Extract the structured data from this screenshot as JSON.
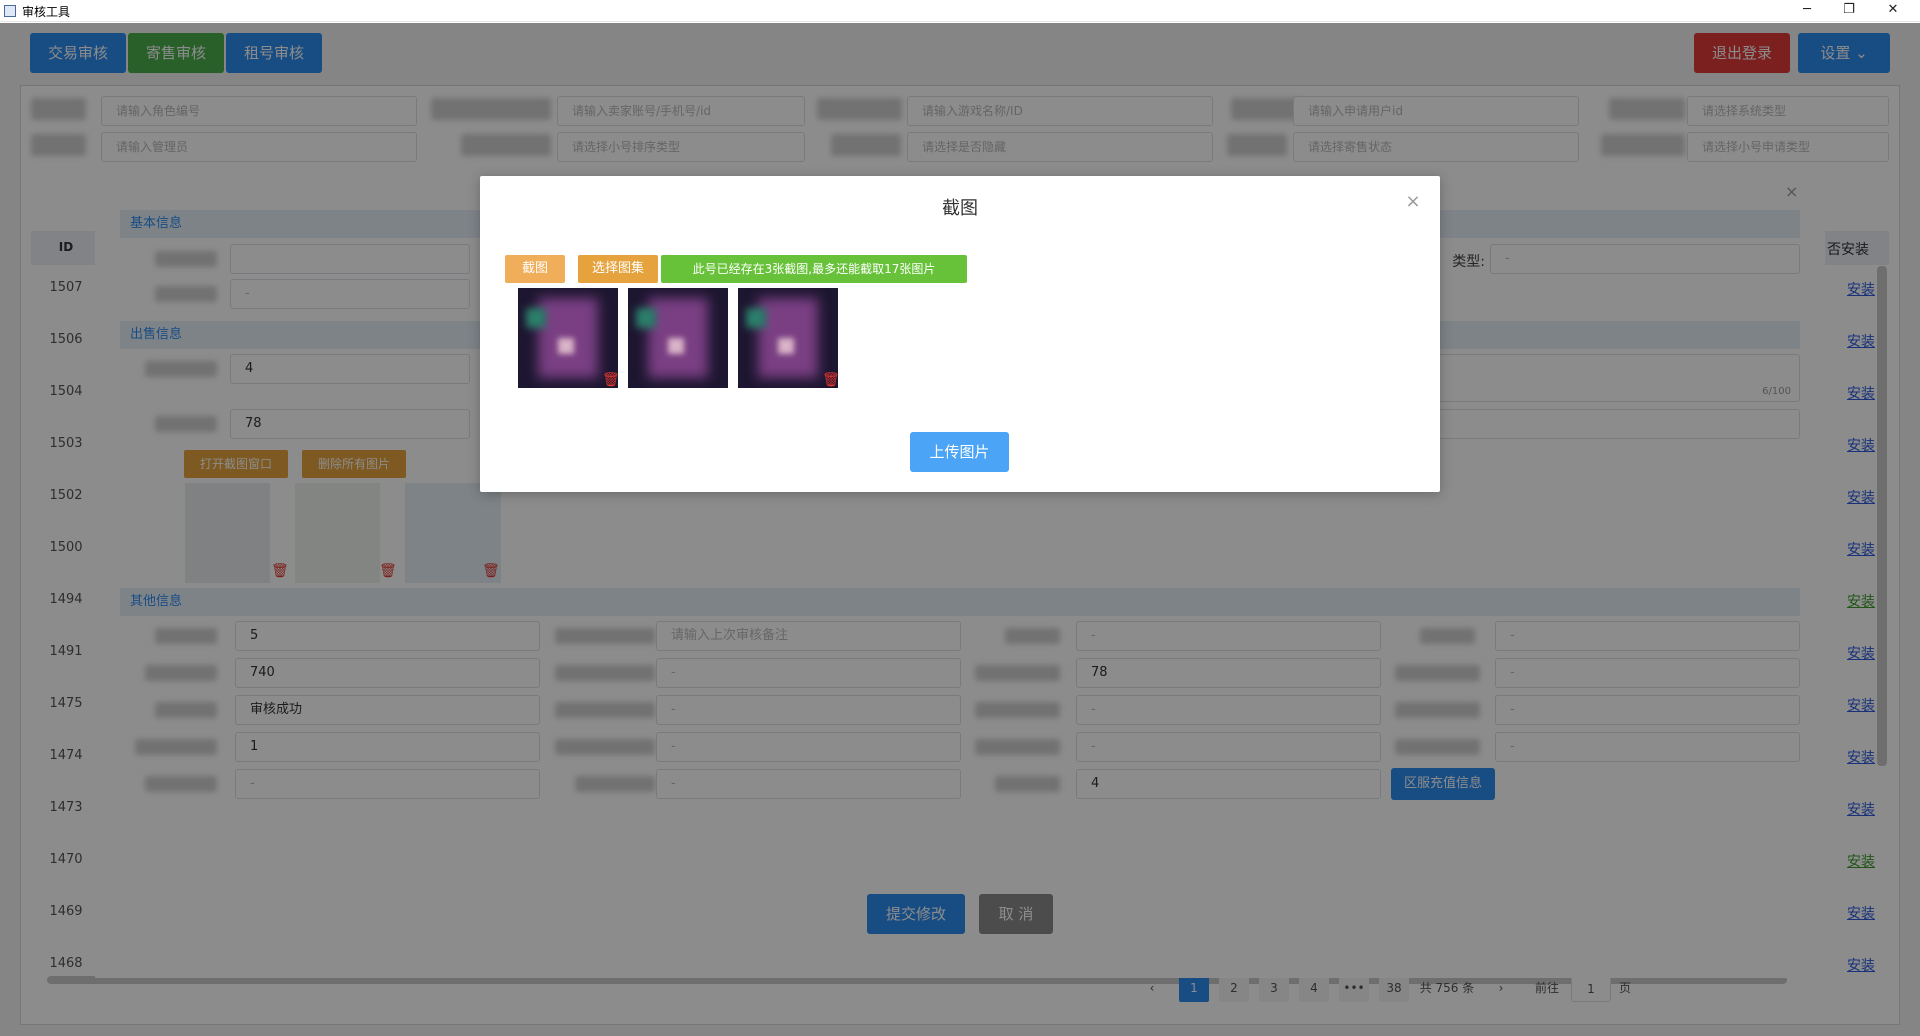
{
  "window": {
    "title": "审核工具",
    "minimize_glyph": "─",
    "maximize_glyph": "❐",
    "close_glyph": "✕"
  },
  "header": {
    "tabs": [
      "交易审核",
      "寄售审核",
      "租号审核"
    ],
    "logout_label": "退出登录",
    "settings_label": "设置"
  },
  "filters": {
    "role_id_placeholder": "请输入角色编号",
    "seller_placeholder": "请输入卖家账号/手机号/id",
    "game_placeholder": "请输入游戏名称/ID",
    "applicant_placeholder": "请输入申请用户id",
    "system_placeholder": "请选择系统类型",
    "admin_placeholder": "请输入管理员",
    "sort_placeholder": "请选择小号排序类型",
    "hidden_placeholder": "请选择是否隐藏",
    "consign_status_placeholder": "请选择寄售状态",
    "apply_type_placeholder": "请选择小号申请类型"
  },
  "table": {
    "id_header": "ID",
    "install_header": "否安装",
    "rows": [
      {
        "id": "1507",
        "install": "安装"
      },
      {
        "id": "1506",
        "install": "安装"
      },
      {
        "id": "1504",
        "install": "安装"
      },
      {
        "id": "1503",
        "install": "安装"
      },
      {
        "id": "1502",
        "install": "安装"
      },
      {
        "id": "1500",
        "install": "安装"
      },
      {
        "id": "1494",
        "install": "安装"
      },
      {
        "id": "1491",
        "install": "安装"
      },
      {
        "id": "1475",
        "install": "安装"
      },
      {
        "id": "1474",
        "install": "安装"
      },
      {
        "id": "1473",
        "install": "安装"
      },
      {
        "id": "1470",
        "install": "安装"
      },
      {
        "id": "1469",
        "install": "安装"
      },
      {
        "id": "1468",
        "install": "安装"
      }
    ]
  },
  "pagination": {
    "prev": "‹",
    "pages": [
      "1",
      "2",
      "3",
      "4",
      "•••",
      "38"
    ],
    "total": "共 756 条",
    "next": "›",
    "goto_label": "前往",
    "goto_value": "1",
    "page_suffix": "页"
  },
  "edit_dialog": {
    "basic_info": "基本信息",
    "sale_info": "出售信息",
    "other_info": "其他信息",
    "type_label": "类型:",
    "dash": "-",
    "qty_value": "4",
    "price_value": "78",
    "char_count": "6/100",
    "open_screenshot": "打开截图窗口",
    "delete_all": "删除所有图片",
    "val_5": "5",
    "last_review_placeholder": "请输入上次审核备注",
    "val_740": "740",
    "val_78": "78",
    "status_value": "审核成功",
    "val_1": "1",
    "val_4": "4",
    "recharge_info": "区服充值信息",
    "submit": "提交修改",
    "cancel": "取 消"
  },
  "screenshot_modal": {
    "title": "截图",
    "close": "×",
    "screenshot_btn": "截图",
    "select_album_btn": "选择图集",
    "info": "此号已经存在3张截图,最多还能截取17张图片",
    "upload": "上传图片"
  },
  "colors": {
    "primary": "#2d8cf0",
    "success": "#4cae4c",
    "danger": "#e23a3a",
    "warning": "#e6a23c",
    "info_green": "#67c23a"
  }
}
